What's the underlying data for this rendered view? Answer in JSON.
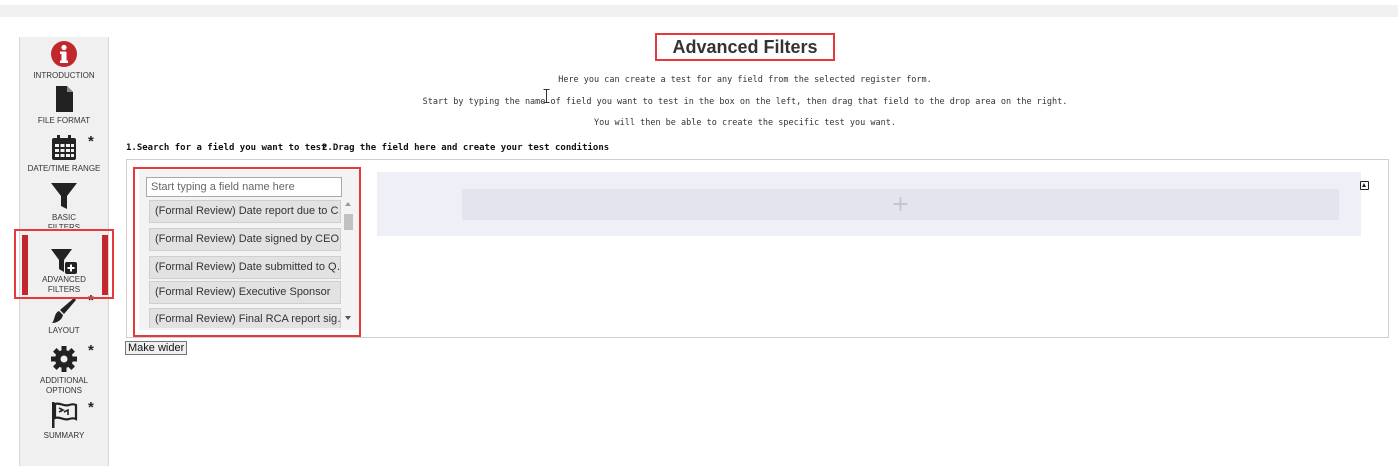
{
  "sidebar": {
    "items": [
      {
        "label": "INTRODUCTION",
        "icon": "info-icon",
        "required": false
      },
      {
        "label": "FILE FORMAT",
        "icon": "file-icon",
        "required": false
      },
      {
        "label": "DATE/TIME RANGE",
        "icon": "calendar-icon",
        "required": true
      },
      {
        "label": "BASIC FILTERS",
        "icon": "filter-icon",
        "required": false
      },
      {
        "label": "ADVANCED FILTERS",
        "icon": "advanced-filter-icon",
        "required": false
      },
      {
        "label": "LAYOUT",
        "icon": "brush-icon",
        "required": true
      },
      {
        "label": "ADDITIONAL OPTIONS",
        "icon": "gear-icon",
        "required": true
      },
      {
        "label": "SUMMARY",
        "icon": "flag-icon",
        "required": true
      }
    ],
    "active": "ADVANCED FILTERS",
    "required_marker": "*"
  },
  "main": {
    "title": "Advanced Filters",
    "instructions": [
      "Here you can create a test for any field from the selected register form.",
      "Start by typing the name of field you want to test in the box on the left, then drag that field to the drop area on the right.",
      "You will then be able to create the specific test you want."
    ],
    "step1_label": "1.Search for a field you want to test",
    "step2_label": "2.Drag the field here and create your test conditions",
    "search_placeholder": "Start typing a field name here",
    "fields": [
      "(Formal Review) Date report due to C…",
      "(Formal Review) Date signed by CEO",
      "(Formal Review) Date submitted to Q…",
      "(Formal Review) Executive Sponsor",
      "(Formal Review) Final RCA report sig…"
    ],
    "drop_plus": "+",
    "make_wider_label": "Make wider"
  },
  "colors": {
    "highlight": "#e5393c",
    "active_bar": "#c1272d",
    "info_icon": "#c0282d",
    "drop_area": "#efeff8"
  }
}
